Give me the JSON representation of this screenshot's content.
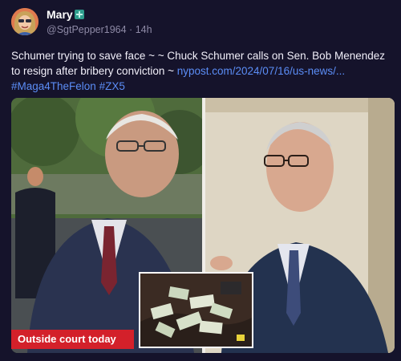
{
  "author": {
    "display_name": "Mary",
    "handle": "@SgtPepper1964",
    "separator": " · ",
    "time": "14h"
  },
  "post": {
    "text_part1": "Schumer trying to save face ~ ~ Chuck Schumer calls on Sen. Bob Menendez to resign after bribery conviction ~ ",
    "link_text": "nypost.com/2024/07/16/us-news/...",
    "hashtag1": "#Maga4TheFelon",
    "hashtag2": "#ZX5"
  },
  "media": {
    "caption": "Outside court today"
  },
  "colors": {
    "background": "#15132b",
    "link": "#5b8df6",
    "caption_bg": "#d3202a"
  },
  "icons": [
    "avatar",
    "verified-badge-icon"
  ]
}
